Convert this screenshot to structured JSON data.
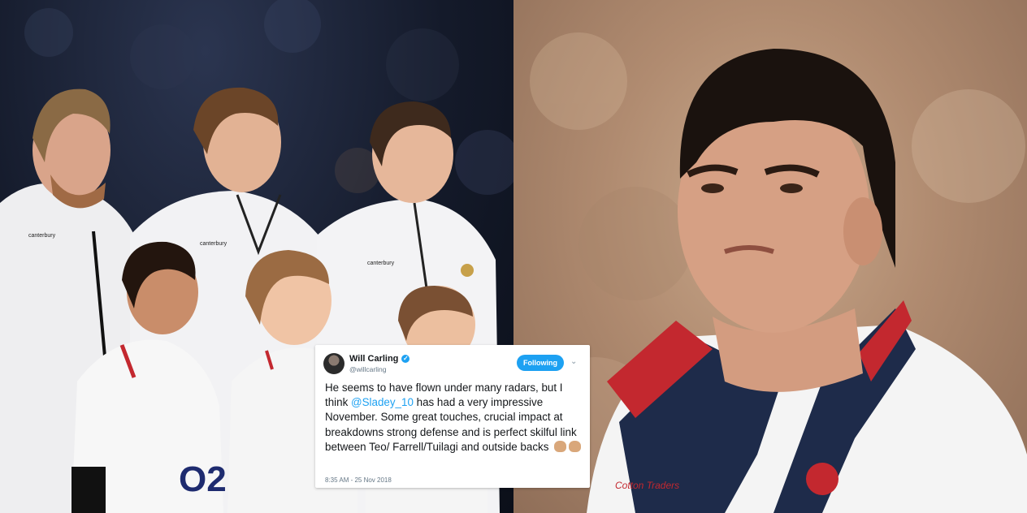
{
  "tweet": {
    "name": "Will Carling",
    "handle": "@willcarling",
    "follow_label": "Following",
    "text_before": "He seems to have flown under many radars, but I think ",
    "mention": "@Sladey_10",
    "text_after": " has had a very impressive November. Some great touches, crucial impact at breakdowns strong defense and is perfect skilful link between Teo/ Farrell/Tuilagi and outside backs",
    "timestamp": "8:35 AM - 25 Nov 2018"
  },
  "left_photo": {
    "shirt_brand_labels": [
      "canterbury",
      "canterbury",
      "canterbury"
    ],
    "kids_shirt_sponsor": "O2"
  },
  "right_photo": {
    "shirt_brand_label": "Cotton Traders"
  },
  "colors": {
    "twitter_blue": "#1da1f2",
    "england_red": "#c3282f",
    "navy": "#1e2b4a"
  }
}
